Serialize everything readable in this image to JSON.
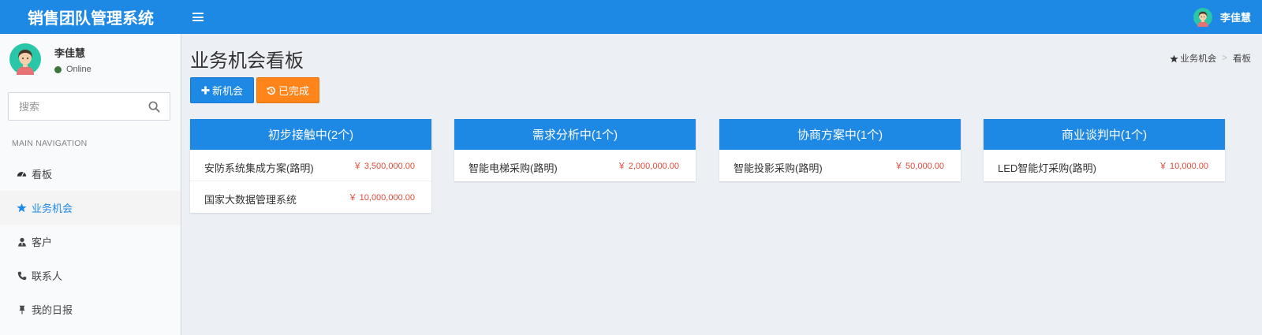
{
  "app": {
    "title": "销售团队管理系统"
  },
  "topbar": {
    "user_name": "李佳慧"
  },
  "sidebar": {
    "user_name": "李佳慧",
    "status": "Online",
    "search_placeholder": "搜索",
    "nav_header": "MAIN NAVIGATION",
    "items": [
      {
        "label": "看板",
        "icon": "dashboard-icon"
      },
      {
        "label": "业务机会",
        "icon": "star-icon"
      },
      {
        "label": "客户",
        "icon": "user-tie-icon"
      },
      {
        "label": "联系人",
        "icon": "phone-icon"
      },
      {
        "label": "我的日报",
        "icon": "pin-icon"
      }
    ]
  },
  "page": {
    "title": "业务机会看板",
    "breadcrumb": {
      "parent": "业务机会",
      "current": "看板"
    }
  },
  "toolbar": {
    "new_label": "新机会",
    "done_label": "已完成"
  },
  "colors": {
    "primary": "#1e88e5",
    "orange": "#ff851b",
    "amount": "#dd4b39",
    "online": "#3c763d"
  },
  "board": {
    "columns": [
      {
        "title": "初步接触中(2个)",
        "items": [
          {
            "name": "安防系统集成方案(路明)",
            "amount": "￥ 3,500,000.00"
          },
          {
            "name": "国家大数据管理系统",
            "amount": "￥ 10,000,000.00"
          }
        ]
      },
      {
        "title": "需求分析中(1个)",
        "items": [
          {
            "name": "智能电梯采购(路明)",
            "amount": "￥ 2,000,000.00"
          }
        ]
      },
      {
        "title": "协商方案中(1个)",
        "items": [
          {
            "name": "智能投影采购(路明)",
            "amount": "￥ 50,000.00"
          }
        ]
      },
      {
        "title": "商业谈判中(1个)",
        "items": [
          {
            "name": "LED智能灯采购(路明)",
            "amount": "￥ 10,000.00"
          }
        ]
      }
    ]
  }
}
